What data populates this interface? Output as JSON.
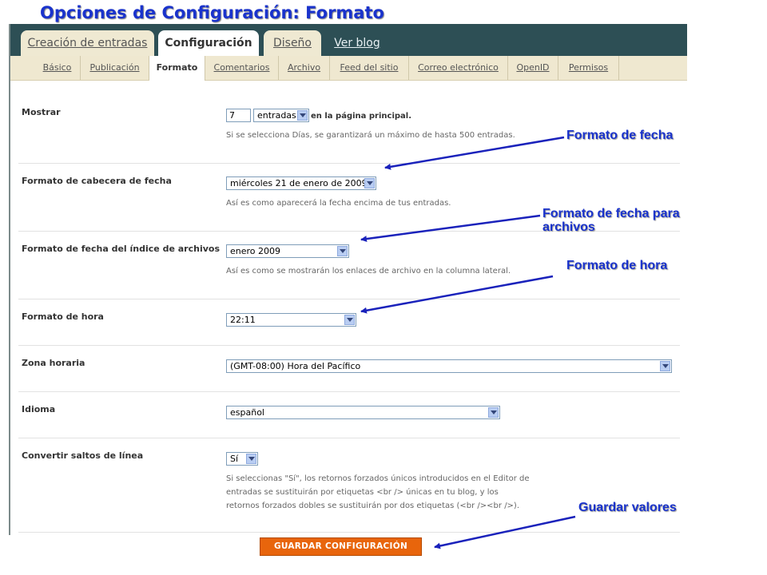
{
  "slide_title": "Opciones de Configuración: Formato",
  "tabs": [
    {
      "label": "Creación de entradas",
      "state": "inactive"
    },
    {
      "label": "Configuración",
      "state": "active"
    },
    {
      "label": "Diseño",
      "state": "inactive"
    },
    {
      "label": "Ver blog",
      "state": "link"
    }
  ],
  "subtabs": [
    {
      "label": "Básico"
    },
    {
      "label": "Publicación"
    },
    {
      "label": "Formato",
      "active": true
    },
    {
      "label": "Comentarios"
    },
    {
      "label": "Archivo"
    },
    {
      "label": "Feed del sitio"
    },
    {
      "label": "Correo electrónico"
    },
    {
      "label": "OpenID"
    },
    {
      "label": "Permisos"
    }
  ],
  "settings": {
    "mostrar": {
      "label": "Mostrar",
      "count_value": "7",
      "unit_value": "entradas",
      "after_text": "en la página principal.",
      "help": "Si se selecciona Días, se garantizará un máximo de hasta 500 entradas."
    },
    "formato_cabecera": {
      "label": "Formato de cabecera de fecha",
      "value": "miércoles 21 de enero de 2009",
      "help": "Así es como aparecerá la fecha encima de tus entradas."
    },
    "formato_archivos": {
      "label": "Formato de fecha del índice de archivos",
      "value": "enero 2009",
      "help": "Así es como se mostrarán los enlaces de archivo en la columna lateral."
    },
    "formato_hora": {
      "label": "Formato de hora",
      "value": "22:11"
    },
    "zona_horaria": {
      "label": "Zona horaria",
      "value": "(GMT-08:00) Hora del Pacífico"
    },
    "idioma": {
      "label": "Idioma",
      "value": "español"
    },
    "saltos_linea": {
      "label": "Convertir saltos de línea",
      "value": "Sí",
      "help_lines": [
        "Si seleccionas \"Sí\", los retornos forzados únicos introducidos en el Editor de",
        "entradas se sustituirán por etiquetas <br /> únicas en tu blog, y los",
        "retornos forzados dobles se sustituirán por dos etiquetas (<br /><br />)."
      ]
    }
  },
  "save_button": "GUARDAR CONFIGURACIÓN",
  "callouts": {
    "fecha": "Formato de fecha",
    "fecha_archivos_line1": "Formato de fecha para",
    "fecha_archivos_line2": "archivos",
    "hora": "Formato de hora",
    "guardar": "Guardar valores"
  },
  "colors": {
    "accent_blue": "#1a33cc",
    "tabbar": "#2d4f55",
    "subnav": "#efe8d0",
    "save_button": "#e8650c"
  }
}
